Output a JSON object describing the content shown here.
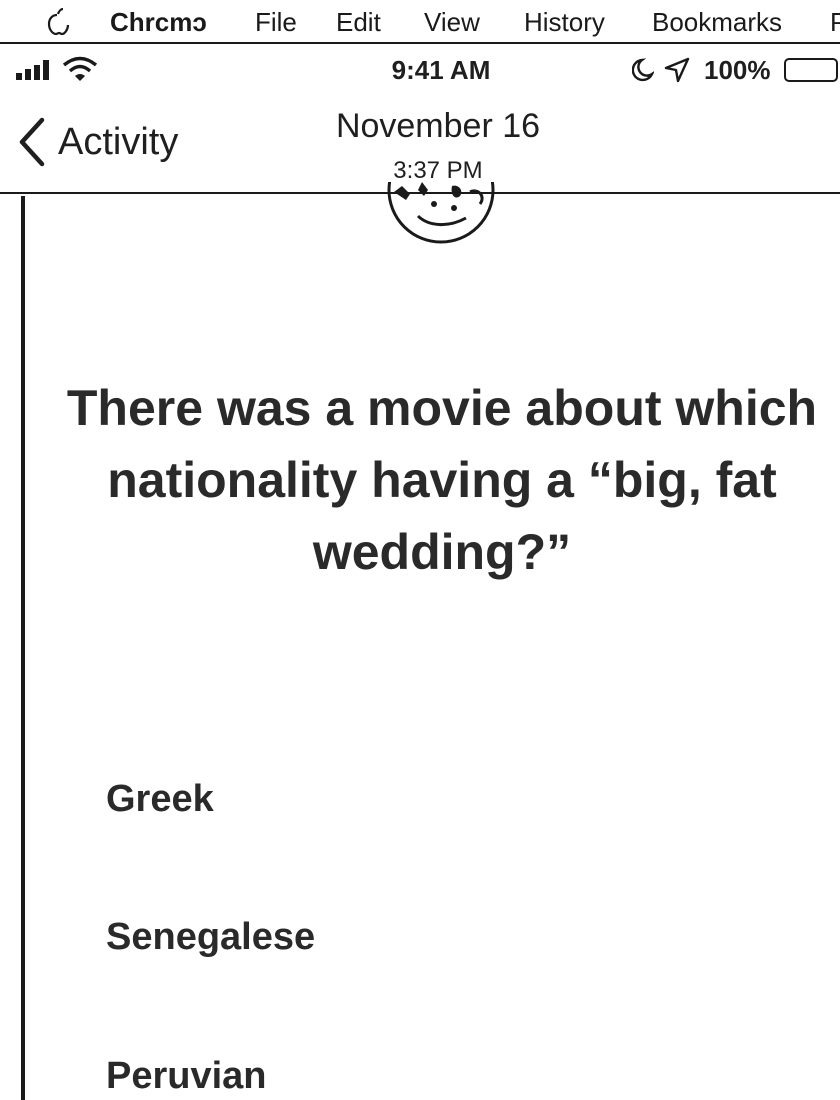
{
  "menubar": {
    "app_name": "Chrcmɔ",
    "items": [
      "File",
      "Edit",
      "View",
      "History",
      "Bookmarks",
      "P"
    ]
  },
  "status_bar": {
    "time": "9:41 AM",
    "battery_percent": "100%"
  },
  "nav": {
    "back_label": "Activity",
    "title": "November 16",
    "subtitle": "3:37 PM"
  },
  "question": {
    "text": "There was a movie about which nationality having a “big, fat wedding?”"
  },
  "answers": [
    {
      "label": "Greek"
    },
    {
      "label": "Senegalese"
    },
    {
      "label": "Peruvian"
    }
  ]
}
